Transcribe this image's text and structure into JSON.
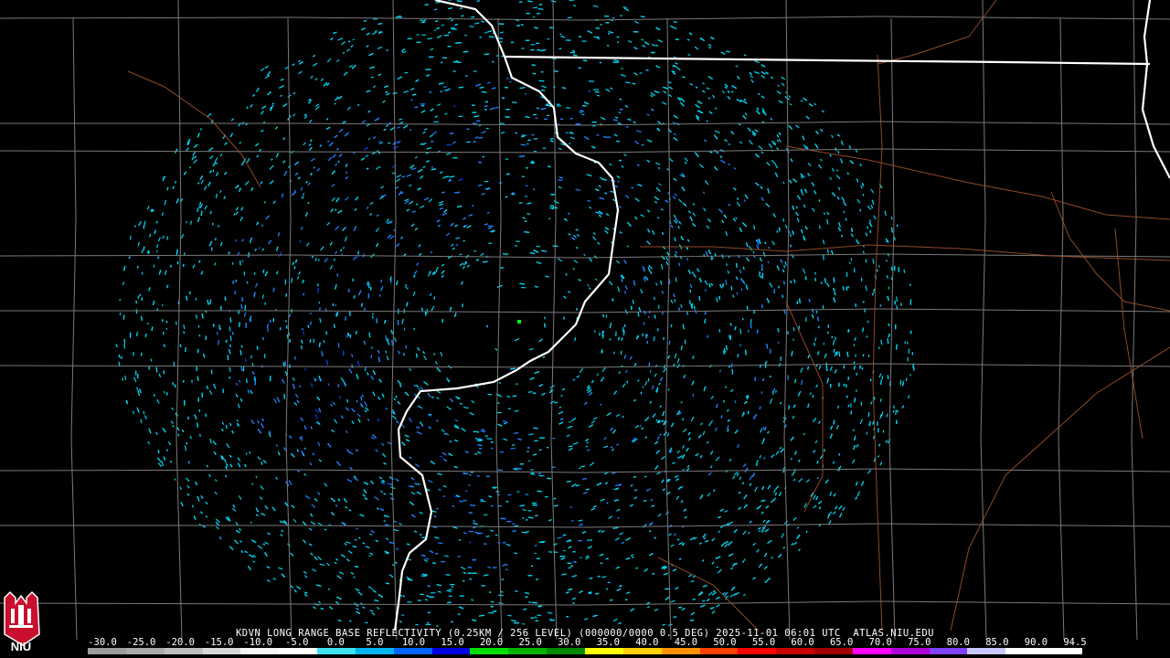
{
  "caption": "KDVN LONG RANGE BASE REFLECTIVITY (0.25KM / 256 LEVEL) (000000/0000 0.5 DEG) 2025-11-01 06:01 UTC  ATLAS.NIU.EDU",
  "logo": {
    "text": "NIU",
    "icon": "niu-castle-logo-icon",
    "colors": {
      "background": "#c8102e",
      "foreground": "#ffffff"
    }
  },
  "scale": {
    "ticks": [
      "-30.0",
      "-25.0",
      "-20.0",
      "-15.0",
      "-10.0",
      "-5.0",
      "0.0",
      "5.0",
      "10.0",
      "15.0",
      "20.0",
      "25.0",
      "30.0",
      "35.0",
      "40.0",
      "45.0",
      "50.0",
      "55.0",
      "60.0",
      "65.0",
      "70.0",
      "75.0",
      "80.0",
      "85.0",
      "90.0",
      "94.5"
    ],
    "range": [
      -30.0,
      94.5
    ],
    "colors": [
      "#9c9c9c",
      "#aaaaaa",
      "#bfbfbf",
      "#d8d8d8",
      "#f5f5f5",
      "#ffffff",
      "#40e0f0",
      "#00b4f0",
      "#0064ff",
      "#0000e0",
      "#00e000",
      "#00b400",
      "#008800",
      "#ffff00",
      "#ffd000",
      "#ff9000",
      "#ff4000",
      "#ff0000",
      "#c80000",
      "#a00000",
      "#ff00ff",
      "#b000d8",
      "#8040ff",
      "#c8c8ff",
      "#ffffff",
      "#ffffff"
    ]
  },
  "map": {
    "state_border_color": "#ffffff",
    "county_line_color": "#7a7a7a",
    "highway_color": "#a0522d",
    "echo_colors": [
      "#00d4f0",
      "#2080ff",
      "#0040e0"
    ]
  }
}
